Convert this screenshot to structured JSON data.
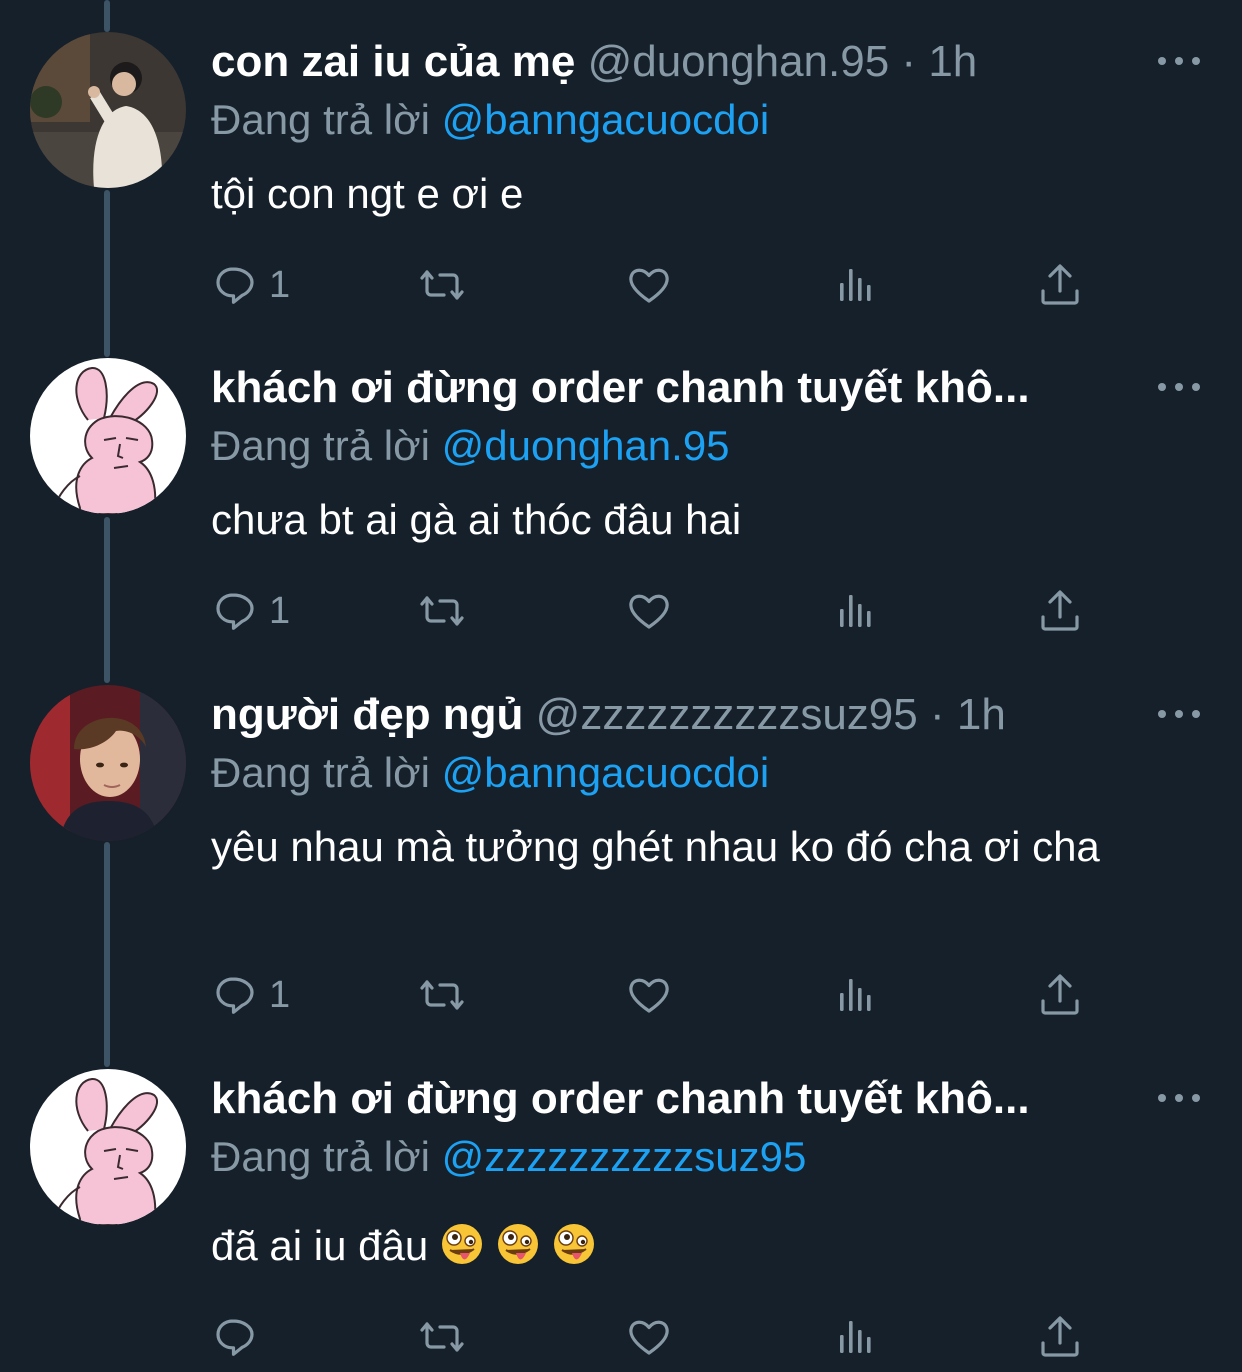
{
  "colors": {
    "background": "#15202b",
    "secondary_text": "#8899a6",
    "mention": "#1da1f2",
    "thread_line": "#3d5466"
  },
  "tweets": [
    {
      "display_name": "con zai iu của mẹ",
      "handle": "@duonghan.95",
      "separator": "·",
      "time": "1h",
      "reply_prefix": "Đang trả lời",
      "reply_to": "@banngacuocdoi",
      "text": "tội con ngt e ơi e",
      "reply_count": "1",
      "avatar": "photo-avatar-person-hoodie"
    },
    {
      "display_name": "khách ơi đừng order chanh tuyết khô...",
      "handle": "",
      "separator": "",
      "time": "",
      "reply_prefix": "Đang trả lời",
      "reply_to": "@duonghan.95",
      "text": "chưa bt ai gà ai thóc đâu hai",
      "reply_count": "1",
      "avatar": "pink-bunny-avatar"
    },
    {
      "display_name": "người đẹp ngủ",
      "handle": "@zzzzzzzzzzsuz95",
      "separator": "·",
      "time": "1h",
      "reply_prefix": "Đang trả lời",
      "reply_to": "@banngacuocdoi",
      "text": "yêu nhau mà tưởng ghét nhau ko đó cha ơi cha",
      "reply_count": "1",
      "avatar": "photo-avatar-person-face"
    },
    {
      "display_name": "khách ơi đừng order chanh tuyết khô...",
      "handle": "",
      "separator": "",
      "time": "",
      "reply_prefix": "Đang trả lời",
      "reply_to": "@zzzzzzzzzzsuz95",
      "text": "đã ai iu đâu",
      "emojis": [
        "zany-face-emoji",
        "zany-face-emoji",
        "zany-face-emoji"
      ],
      "reply_count": "",
      "avatar": "pink-bunny-avatar"
    }
  ],
  "action_icons": [
    "reply-icon",
    "retweet-icon",
    "like-icon",
    "views-icon",
    "share-icon"
  ]
}
